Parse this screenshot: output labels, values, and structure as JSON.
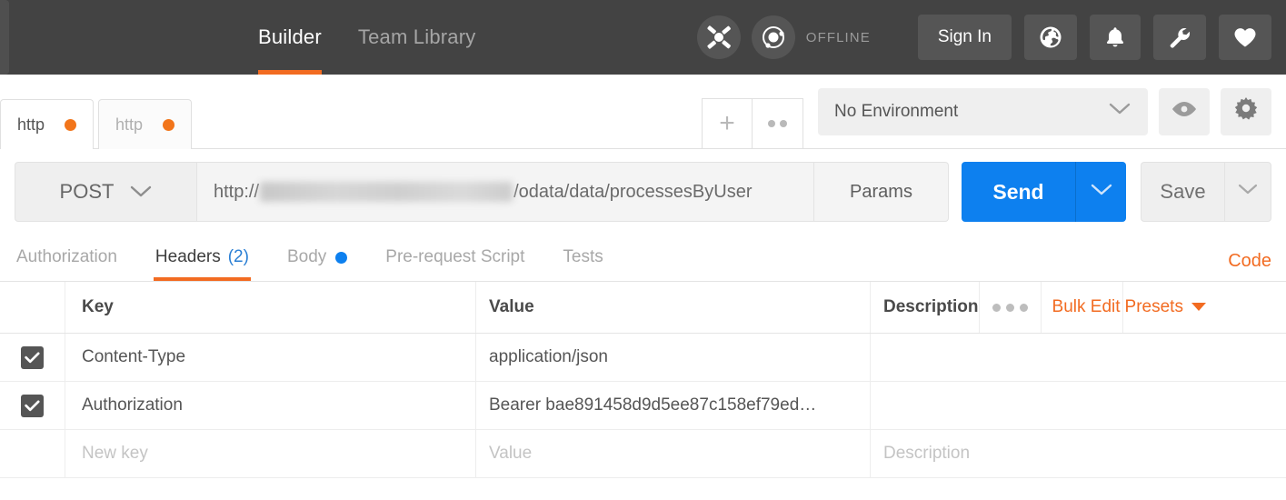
{
  "header": {
    "nav": [
      {
        "label": "Builder",
        "active": true
      },
      {
        "label": "Team Library",
        "active": false
      }
    ],
    "network_icon": "network-nodes-icon",
    "sync_icon": "sync-orbit-icon",
    "status": "OFFLINE",
    "signin_label": "Sign In",
    "buttons": [
      {
        "name": "globe-icon"
      },
      {
        "name": "bell-icon"
      },
      {
        "name": "wrench-icon"
      },
      {
        "name": "heart-icon"
      }
    ]
  },
  "tabs": {
    "items": [
      {
        "label": "http",
        "unsaved": true,
        "active": true
      },
      {
        "label": "http",
        "unsaved": true,
        "active": false
      }
    ],
    "new_tab_label": "+",
    "menu_icon": "two-dots-icon"
  },
  "environment": {
    "selected": "No Environment",
    "eye_icon": "eye-icon",
    "gear_icon": "gear-icon"
  },
  "request": {
    "method": "POST",
    "url_prefix": "http://",
    "url_redacted": "aaaaaaaaaaaaaaaaaaaaaaaaa",
    "url_suffix": "/odata/data/processesByUser",
    "params_label": "Params",
    "send_label": "Send",
    "save_label": "Save"
  },
  "request_tabs": {
    "items": [
      {
        "label": "Authorization",
        "active": false,
        "badge": "",
        "dot": false
      },
      {
        "label": "Headers",
        "active": true,
        "badge": "(2)",
        "dot": false
      },
      {
        "label": "Body",
        "active": false,
        "badge": "",
        "dot": true
      },
      {
        "label": "Pre-request Script",
        "active": false,
        "badge": "",
        "dot": false
      },
      {
        "label": "Tests",
        "active": false,
        "badge": "",
        "dot": false
      }
    ],
    "code_link": "Code"
  },
  "headers_table": {
    "columns": {
      "key": "Key",
      "value": "Value",
      "description": "Description"
    },
    "tools": {
      "more_icon": "three-dots-icon",
      "bulk_edit": "Bulk Edit",
      "presets": "Presets"
    },
    "rows": [
      {
        "enabled": true,
        "key": "Content-Type",
        "value": "application/json",
        "description": ""
      },
      {
        "enabled": true,
        "key": "Authorization",
        "value": "Bearer bae891458d9d5ee87c158ef79ed…",
        "description": ""
      }
    ],
    "new_row": {
      "key_placeholder": "New key",
      "value_placeholder": "Value",
      "description_placeholder": "Description"
    }
  },
  "colors": {
    "header_bg": "#434343",
    "accent_orange": "#f26b21",
    "send_blue": "#0d80ef",
    "badge_blue": "#2a7fd4"
  }
}
